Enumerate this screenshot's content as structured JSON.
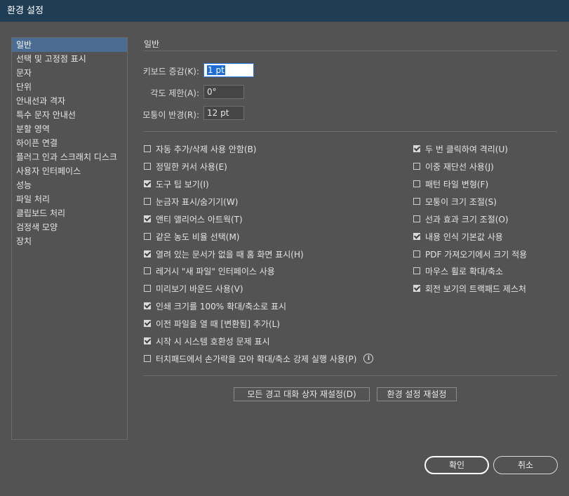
{
  "window": {
    "title": "환경 설정"
  },
  "sidebar": {
    "items": [
      {
        "label": "일반",
        "selected": true
      },
      {
        "label": "선택 및 고정점 표시",
        "selected": false
      },
      {
        "label": "문자",
        "selected": false
      },
      {
        "label": "단위",
        "selected": false
      },
      {
        "label": "안내선과 격자",
        "selected": false
      },
      {
        "label": "특수 문자 안내선",
        "selected": false
      },
      {
        "label": "분할 영역",
        "selected": false
      },
      {
        "label": "하이픈 연결",
        "selected": false
      },
      {
        "label": "플러그 인과 스크래치 디스크",
        "selected": false
      },
      {
        "label": "사용자 인터페이스",
        "selected": false
      },
      {
        "label": "성능",
        "selected": false
      },
      {
        "label": "파일 처리",
        "selected": false
      },
      {
        "label": "클립보드 처리",
        "selected": false
      },
      {
        "label": "검정색 모양",
        "selected": false
      },
      {
        "label": "장치",
        "selected": false
      }
    ]
  },
  "general": {
    "section_title": "일반",
    "fields": {
      "keyboard_increment": {
        "label": "키보드 증감(K):",
        "value": "1 pt"
      },
      "constrain_angle": {
        "label": "각도 제한(A):",
        "value": "0°"
      },
      "corner_radius": {
        "label": "모퉁이 반경(R):",
        "value": "12 pt"
      }
    },
    "left_checkboxes": [
      {
        "label": "자동 추가/삭제 사용 안함(B)",
        "checked": false
      },
      {
        "label": "정밀한 커서 사용(E)",
        "checked": false
      },
      {
        "label": "도구 팁 보기(I)",
        "checked": true
      },
      {
        "label": "눈금자 표시/숨기기(W)",
        "checked": false
      },
      {
        "label": "앤티 앨리어스 아트웍(T)",
        "checked": true
      },
      {
        "label": "같은 농도 비율 선택(M)",
        "checked": false
      },
      {
        "label": "열려 있는 문서가 없을 때 홈 화면 표시(H)",
        "checked": true
      },
      {
        "label": "레거시 \"새 파일\" 인터페이스 사용",
        "checked": false
      },
      {
        "label": "미리보기 바운드 사용(V)",
        "checked": false
      },
      {
        "label": "인쇄 크기를 100% 확대/축소로 표시",
        "checked": true
      },
      {
        "label": "이전 파일을 열 때 [변환됨] 추가(L)",
        "checked": true
      },
      {
        "label": "시작 시 시스템 호환성 문제 표시",
        "checked": true
      },
      {
        "label": "터치패드에서 손가락을 모아 확대/축소 강제 실행 사용(P)",
        "checked": false
      }
    ],
    "right_checkboxes": [
      {
        "label": "두 번 클릭하여 격리(U)",
        "checked": true
      },
      {
        "label": "이중 재단선 사용(J)",
        "checked": false
      },
      {
        "label": "패턴 타일 변형(F)",
        "checked": false
      },
      {
        "label": "모퉁이 크기 조절(S)",
        "checked": false
      },
      {
        "label": "선과 효과 크기 조절(O)",
        "checked": false
      },
      {
        "label": "내용 인식 기본값 사용",
        "checked": true
      },
      {
        "label": "PDF 가져오기에서 크기 적용",
        "checked": false
      },
      {
        "label": "마우스 휠로 확대/축소",
        "checked": false
      },
      {
        "label": "회전 보기의 트랙패드 제스처",
        "checked": true
      }
    ],
    "reset_warnings_label": "모든 경고 대화 상자 재설정(D)",
    "reset_prefs_label": "환경 설정 재설정"
  },
  "footer": {
    "ok_label": "확인",
    "cancel_label": "취소"
  }
}
